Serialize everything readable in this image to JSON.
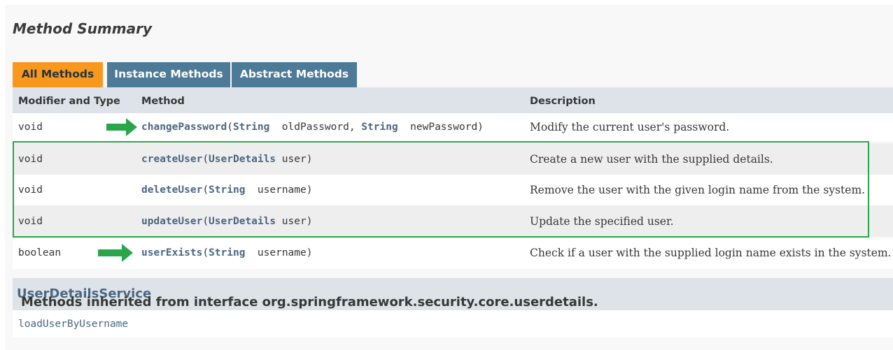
{
  "section_title": "Method Summary",
  "tabs": [
    {
      "label": "All Methods",
      "active": true
    },
    {
      "label": "Instance Methods",
      "active": false
    },
    {
      "label": "Abstract Methods",
      "active": false
    }
  ],
  "table": {
    "headers": {
      "modifier": "Modifier and Type",
      "method": "Method",
      "description": "Description"
    },
    "rows": [
      {
        "type": "void",
        "name": "changePassword",
        "sig_a": "(",
        "p1_type": "String",
        "p1_name": "  oldPassword, ",
        "p2_type": "String",
        "p2_name": "  newPassword)",
        "description": "Modify the current user's password.",
        "arrow": true
      },
      {
        "type": "void",
        "name": "createUser",
        "sig_a": "(",
        "p1_type": "UserDetails",
        "p1_name": " user)",
        "description": "Create a new user with the supplied details."
      },
      {
        "type": "void",
        "name": "deleteUser",
        "sig_a": "(",
        "p1_type": "String",
        "p1_name": "  username)",
        "description": "Remove the user with the given login name from the system."
      },
      {
        "type": "void",
        "name": "updateUser",
        "sig_a": "(",
        "p1_type": "UserDetails",
        "p1_name": " user)",
        "description": "Update the specified user."
      },
      {
        "type": "boolean",
        "name": "userExists",
        "sig_a": "(",
        "p1_type": "String",
        "p1_name": "  username)",
        "description": "Check if a user with the supplied login name exists in the system.",
        "arrow": true
      }
    ]
  },
  "inherited": {
    "heading_prefix": "Methods inherited from interface org.springframework.security.core.userdetails.",
    "heading_link": "UserDetailsService",
    "methods": "loadUserByUsername"
  },
  "colors": {
    "active_tab": "#f8981d",
    "inactive_tab": "#4d7a97",
    "link": "#4a6782",
    "annotation_green": "#2aa64a"
  },
  "icons": [
    "arrow-right-icon"
  ]
}
